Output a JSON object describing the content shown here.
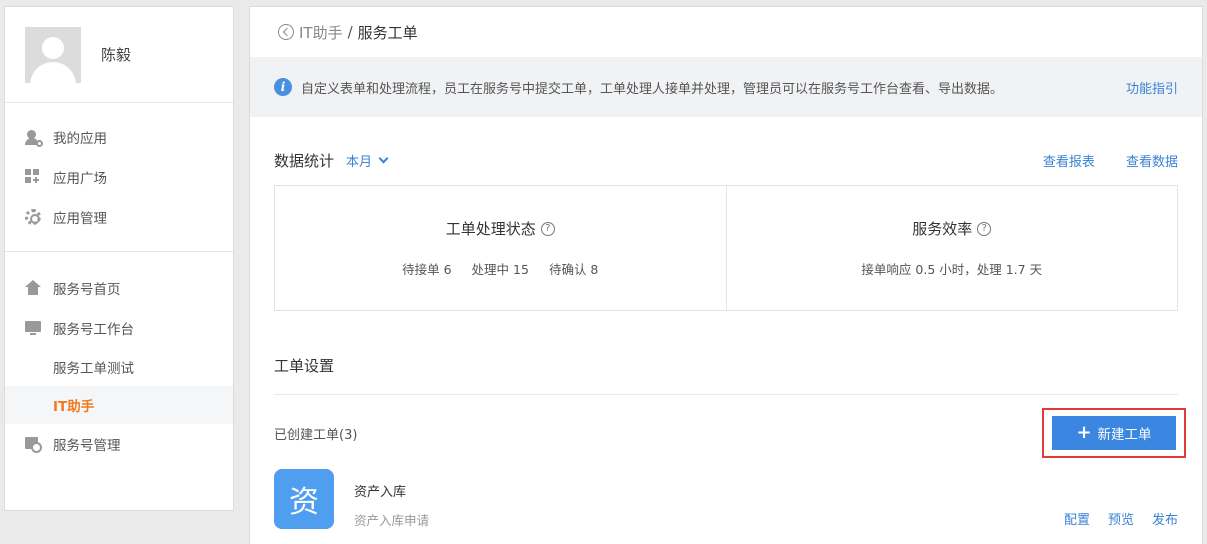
{
  "sidebar": {
    "user_name": "陈毅",
    "groups": [
      {
        "items": [
          {
            "label": "我的应用",
            "icon": "user-app-icon"
          },
          {
            "label": "应用广场",
            "icon": "grid-icon"
          },
          {
            "label": "应用管理",
            "icon": "gear-icon"
          }
        ]
      },
      {
        "items": [
          {
            "label": "服务号首页",
            "icon": "home-icon"
          },
          {
            "label": "服务号工作台",
            "icon": "monitor-icon"
          },
          {
            "label": "服务工单测试"
          },
          {
            "label": "IT助手",
            "active": true
          },
          {
            "label": "服务号管理",
            "icon": "manage-icon"
          }
        ]
      }
    ]
  },
  "breadcrumb": {
    "parent": "IT助手",
    "separator": "/",
    "current": "服务工单"
  },
  "notice": {
    "text": "自定义表单和处理流程，员工在服务号中提交工单，工单处理人接单并处理，管理员可以在服务号工作台查看、导出数据。",
    "link": "功能指引"
  },
  "stats_section": {
    "title": "数据统计",
    "period": "本月",
    "links": [
      "查看报表",
      "查看数据"
    ],
    "boxes": [
      {
        "title": "工单处理状态",
        "values": [
          "待接单 6",
          "处理中 15",
          "待确认 8"
        ]
      },
      {
        "title": "服务效率",
        "values": [
          "接单响应 0.5 小时，处理 1.7 天"
        ]
      }
    ]
  },
  "settings": {
    "title": "工单设置",
    "created_label": "已创建工单(3)",
    "new_button": "新建工单",
    "items": [
      {
        "icon_char": "资",
        "name": "资产入库",
        "desc": "资产入库申请",
        "actions": [
          "配置",
          "预览",
          "发布"
        ]
      }
    ]
  },
  "colors": {
    "accent": "#3a86e0",
    "active_nav": "#f07a20",
    "highlight_box": "#e23b3b",
    "item_icon_bg": "#4f9ef0"
  }
}
